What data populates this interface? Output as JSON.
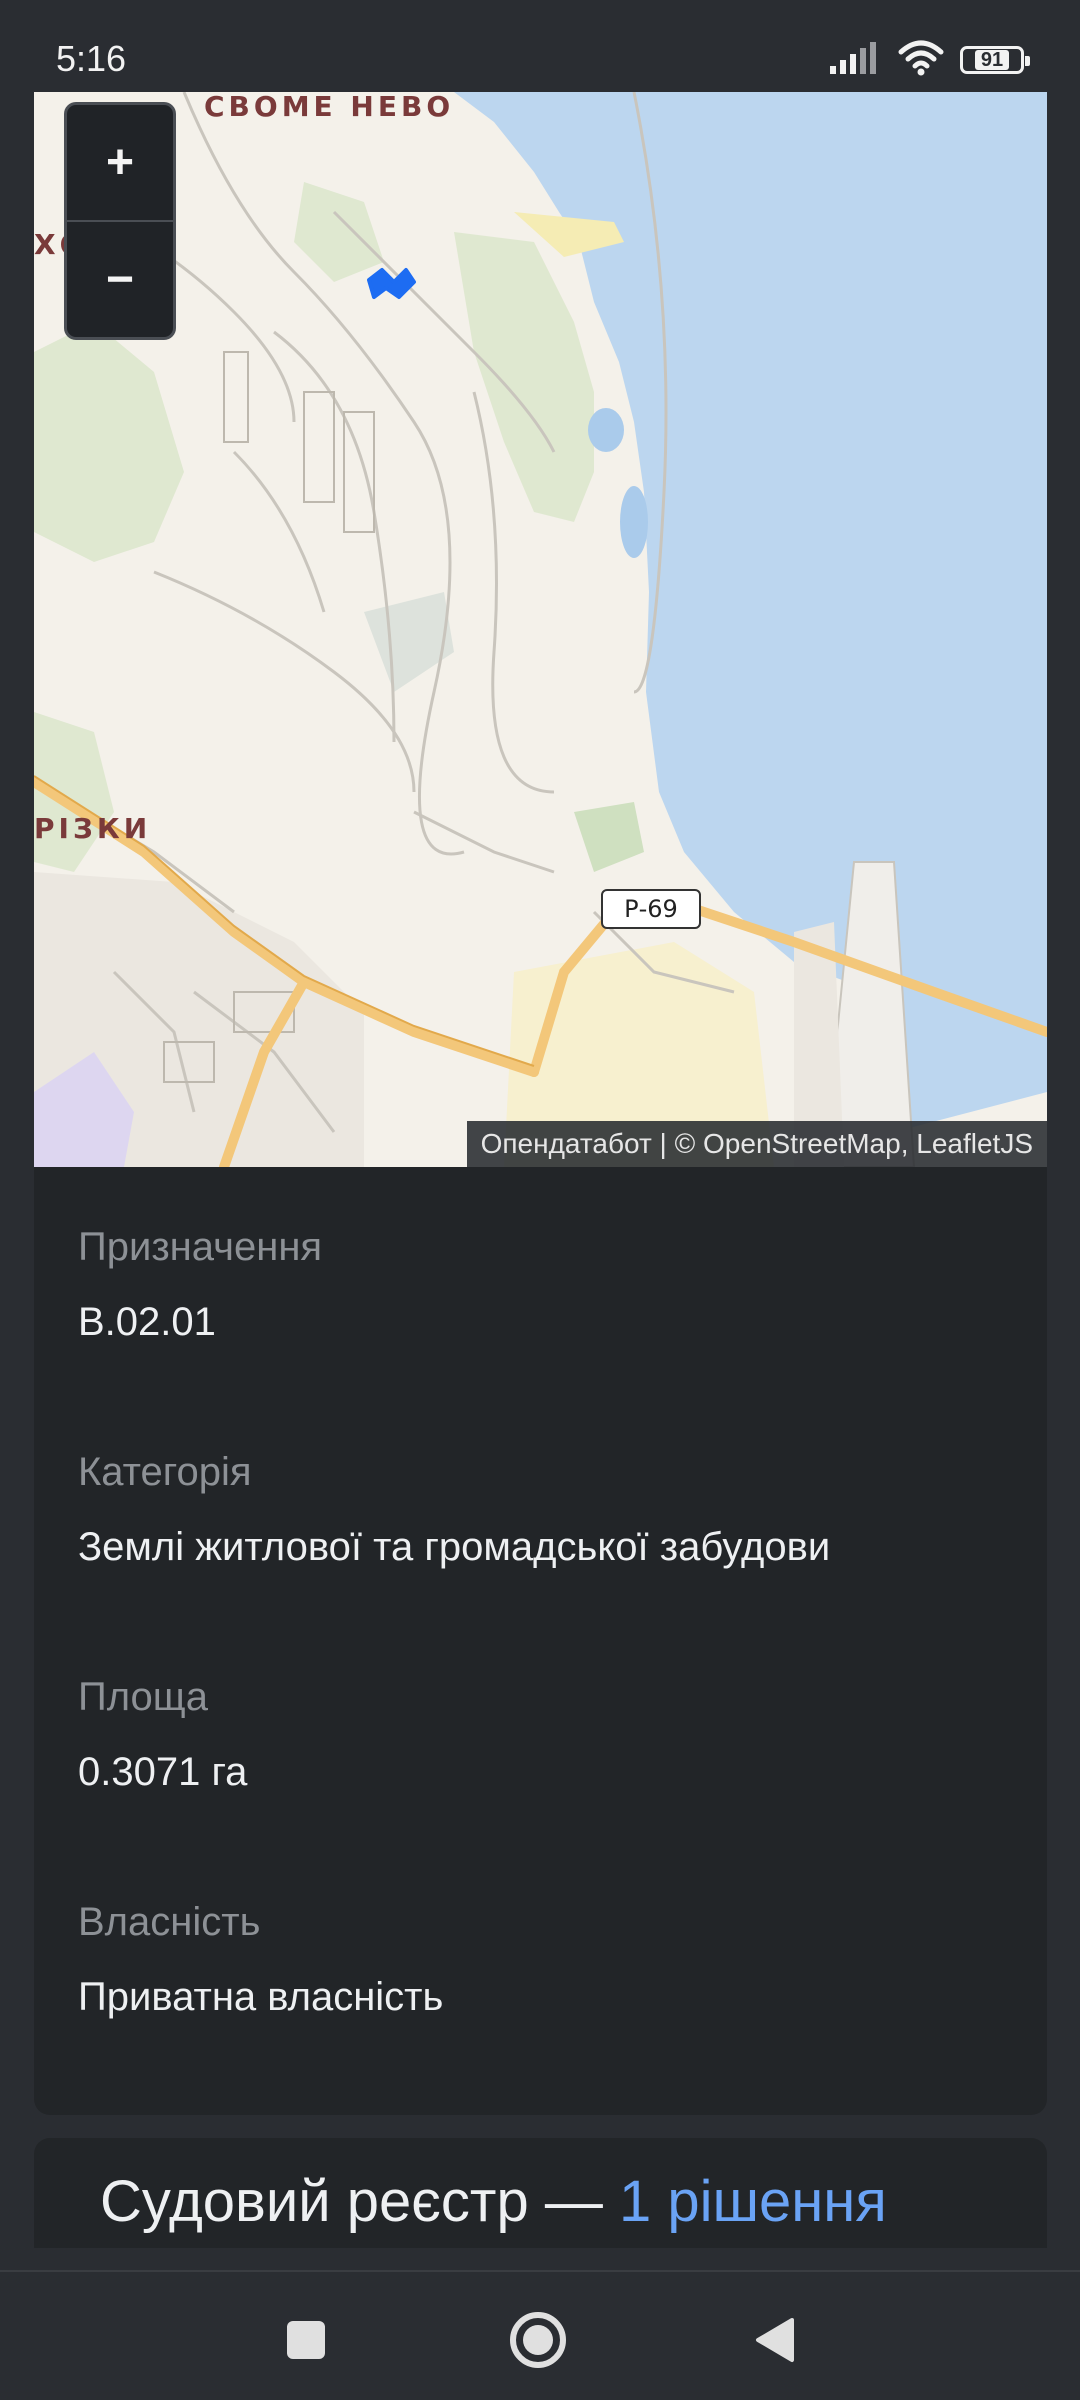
{
  "status_bar": {
    "time": "5:16",
    "battery": "91"
  },
  "map": {
    "zoom_in": "+",
    "zoom_out": "−",
    "labels": [
      "СВОМЕ НЕВО",
      "ХОСПІЯ",
      "РІЗКИ"
    ],
    "road_badge": "Р-69",
    "attribution": "Опендатабот | © OpenStreetMap, LeafletJS",
    "colors": {
      "land": "#f4f1ea",
      "water": "#bcd6ef",
      "park": "#dfe8d0",
      "road_major": "#f3c77a",
      "marker": "#1d6cf2"
    }
  },
  "details": {
    "fields": [
      {
        "label": "Призначення",
        "value": "В.02.01"
      },
      {
        "label": "Категорія",
        "value": "Землі житлової та громадської забудови"
      },
      {
        "label": "Площа",
        "value": "0.3071 га"
      },
      {
        "label": "Власність",
        "value": "Приватна власність"
      }
    ]
  },
  "court_registry": {
    "title": "Судовий реєстр — ",
    "link": "1 рішення"
  },
  "nav": {
    "icons": [
      "square-icon",
      "home-circle-icon",
      "back-triangle-icon"
    ]
  }
}
